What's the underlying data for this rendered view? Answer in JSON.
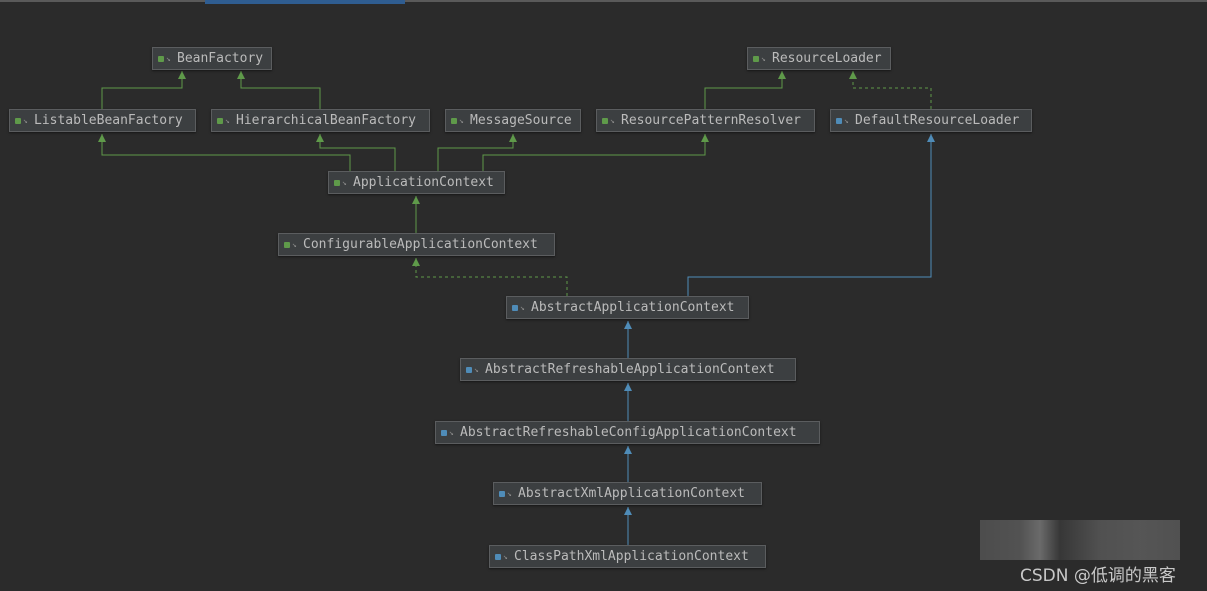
{
  "colors": {
    "background": "#2b2b2b",
    "interface": "#5f9a4a",
    "class": "#4f8cb8",
    "implements_edge": "#5f9a4a",
    "extends_edge": "#4f8cb8"
  },
  "nodes": [
    {
      "label": "BeanFactory",
      "kind": "interface"
    },
    {
      "label": "ResourceLoader",
      "kind": "interface"
    },
    {
      "label": "ListableBeanFactory",
      "kind": "interface"
    },
    {
      "label": "HierarchicalBeanFactory",
      "kind": "interface"
    },
    {
      "label": "MessageSource",
      "kind": "interface"
    },
    {
      "label": "ResourcePatternResolver",
      "kind": "interface"
    },
    {
      "label": "DefaultResourceLoader",
      "kind": "class"
    },
    {
      "label": "ApplicationContext",
      "kind": "interface"
    },
    {
      "label": "ConfigurableApplicationContext",
      "kind": "interface"
    },
    {
      "label": "AbstractApplicationContext",
      "kind": "class"
    },
    {
      "label": "AbstractRefreshableApplicationContext",
      "kind": "class"
    },
    {
      "label": "AbstractRefreshableConfigApplicationContext",
      "kind": "class"
    },
    {
      "label": "AbstractXmlApplicationContext",
      "kind": "class"
    },
    {
      "label": "ClassPathXmlApplicationContext",
      "kind": "class"
    }
  ],
  "edges": [
    {
      "from": "ListableBeanFactory",
      "to": "BeanFactory",
      "type": "extends-interface"
    },
    {
      "from": "HierarchicalBeanFactory",
      "to": "BeanFactory",
      "type": "extends-interface"
    },
    {
      "from": "ResourcePatternResolver",
      "to": "ResourceLoader",
      "type": "extends-interface"
    },
    {
      "from": "DefaultResourceLoader",
      "to": "ResourceLoader",
      "type": "implements"
    },
    {
      "from": "ApplicationContext",
      "to": "ListableBeanFactory",
      "type": "extends-interface"
    },
    {
      "from": "ApplicationContext",
      "to": "HierarchicalBeanFactory",
      "type": "extends-interface"
    },
    {
      "from": "ApplicationContext",
      "to": "MessageSource",
      "type": "extends-interface"
    },
    {
      "from": "ApplicationContext",
      "to": "ResourcePatternResolver",
      "type": "extends-interface"
    },
    {
      "from": "ConfigurableApplicationContext",
      "to": "ApplicationContext",
      "type": "extends-interface"
    },
    {
      "from": "AbstractApplicationContext",
      "to": "ConfigurableApplicationContext",
      "type": "implements"
    },
    {
      "from": "AbstractApplicationContext",
      "to": "DefaultResourceLoader",
      "type": "extends"
    },
    {
      "from": "AbstractRefreshableApplicationContext",
      "to": "AbstractApplicationContext",
      "type": "extends"
    },
    {
      "from": "AbstractRefreshableConfigApplicationContext",
      "to": "AbstractRefreshableApplicationContext",
      "type": "extends"
    },
    {
      "from": "AbstractXmlApplicationContext",
      "to": "AbstractRefreshableConfigApplicationContext",
      "type": "extends"
    },
    {
      "from": "ClassPathXmlApplicationContext",
      "to": "AbstractXmlApplicationContext",
      "type": "extends"
    }
  ],
  "watermark": "CSDN @低调的黑客"
}
